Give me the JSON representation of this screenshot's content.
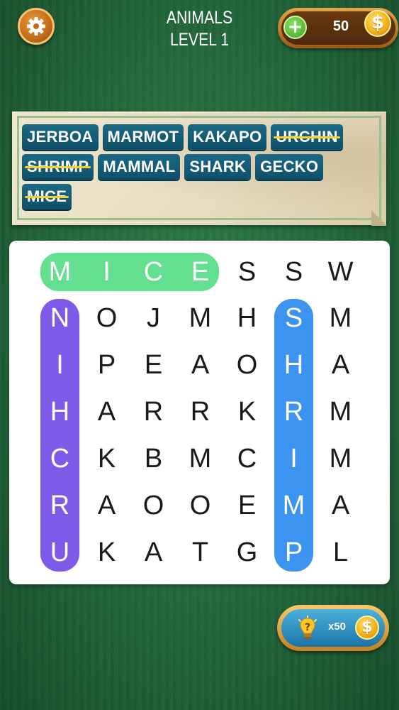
{
  "header": {
    "category": "ANIMALS",
    "level": "LEVEL 1",
    "settings_icon": "gear-icon",
    "coins": "50",
    "plus_symbol": "+",
    "coin_symbol": "$"
  },
  "words": [
    {
      "text": "JERBOA",
      "found": false
    },
    {
      "text": "MARMOT",
      "found": false
    },
    {
      "text": "KAKAPO",
      "found": false
    },
    {
      "text": "URCHIN",
      "found": true
    },
    {
      "text": "SHRIMP",
      "found": true
    },
    {
      "text": "MAMMAL",
      "found": false
    },
    {
      "text": "SHARK",
      "found": false
    },
    {
      "text": "GECKO",
      "found": false
    },
    {
      "text": "MICE",
      "found": true
    }
  ],
  "grid": [
    [
      "M",
      "I",
      "C",
      "E",
      "S",
      "S",
      "W"
    ],
    [
      "N",
      "O",
      "J",
      "M",
      "H",
      "S",
      "M"
    ],
    [
      "I",
      "P",
      "E",
      "A",
      "O",
      "H",
      "A"
    ],
    [
      "H",
      "A",
      "R",
      "R",
      "K",
      "R",
      "M"
    ],
    [
      "C",
      "K",
      "B",
      "M",
      "C",
      "I",
      "M"
    ],
    [
      "R",
      "A",
      "O",
      "O",
      "E",
      "M",
      "A"
    ],
    [
      "U",
      "K",
      "A",
      "T",
      "G",
      "P",
      "L"
    ]
  ],
  "highlights": [
    {
      "word": "MICE",
      "color": "#64de8f"
    },
    {
      "word": "URCHIN",
      "color": "#7d5ae8"
    },
    {
      "word": "SHRIMP",
      "color": "#3d93f0"
    }
  ],
  "hint": {
    "icon": "lightbulb-question-icon",
    "cost": "x50",
    "coin_symbol": "$"
  }
}
